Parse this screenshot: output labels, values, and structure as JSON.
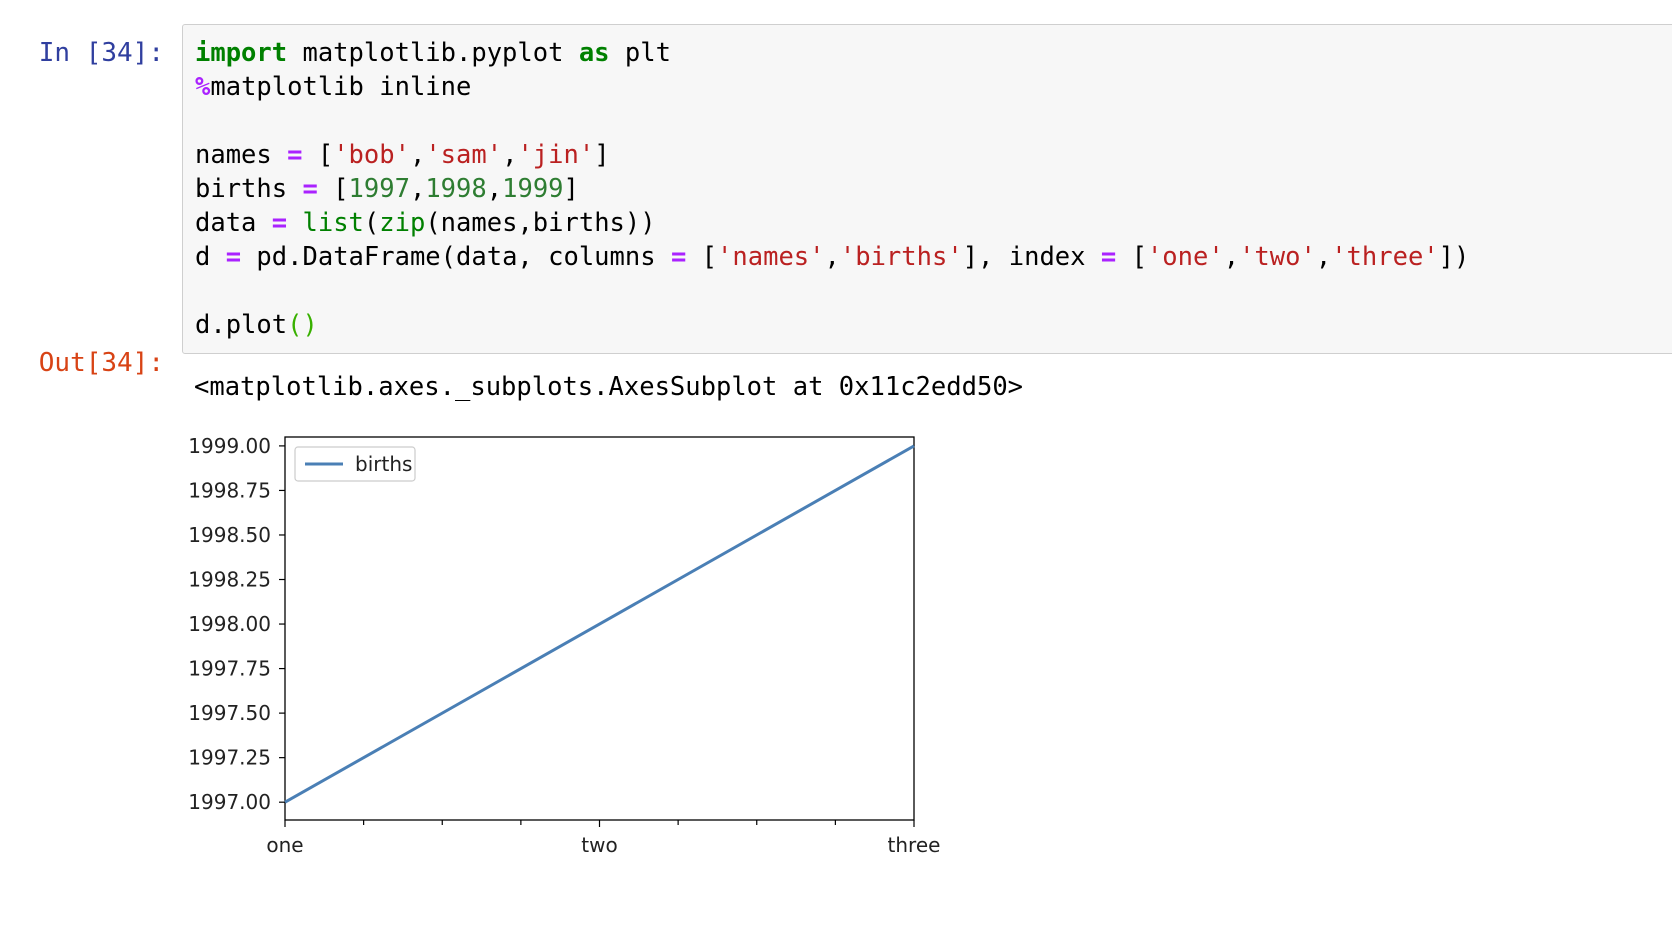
{
  "cell": {
    "in_prompt": "In [34]:",
    "out_prompt": "Out[34]:",
    "code_lines": [
      [
        {
          "t": "import",
          "c": "kw"
        },
        {
          "t": " matplotlib.pyplot "
        },
        {
          "t": "as",
          "c": "kw"
        },
        {
          "t": " plt"
        }
      ],
      [
        {
          "t": "%",
          "c": "op"
        },
        {
          "t": "matplotlib inline"
        }
      ],
      [],
      [
        {
          "t": "names "
        },
        {
          "t": "=",
          "c": "op"
        },
        {
          "t": " ["
        },
        {
          "t": "'bob'",
          "c": "str"
        },
        {
          "t": ","
        },
        {
          "t": "'sam'",
          "c": "str"
        },
        {
          "t": ","
        },
        {
          "t": "'jin'",
          "c": "str"
        },
        {
          "t": "]"
        }
      ],
      [
        {
          "t": "births "
        },
        {
          "t": "=",
          "c": "op"
        },
        {
          "t": " ["
        },
        {
          "t": "1997",
          "c": "num"
        },
        {
          "t": ","
        },
        {
          "t": "1998",
          "c": "num"
        },
        {
          "t": ","
        },
        {
          "t": "1999",
          "c": "num"
        },
        {
          "t": "]"
        }
      ],
      [
        {
          "t": "data "
        },
        {
          "t": "=",
          "c": "op"
        },
        {
          "t": " "
        },
        {
          "t": "list",
          "c": "bi"
        },
        {
          "t": "("
        },
        {
          "t": "zip",
          "c": "bi"
        },
        {
          "t": "(names,births))"
        }
      ],
      [
        {
          "t": "d "
        },
        {
          "t": "=",
          "c": "op"
        },
        {
          "t": " pd.DataFrame(data, columns "
        },
        {
          "t": "=",
          "c": "op"
        },
        {
          "t": " ["
        },
        {
          "t": "'names'",
          "c": "str"
        },
        {
          "t": ","
        },
        {
          "t": "'births'",
          "c": "str"
        },
        {
          "t": "], index "
        },
        {
          "t": "=",
          "c": "op"
        },
        {
          "t": " ["
        },
        {
          "t": "'one'",
          "c": "str"
        },
        {
          "t": ","
        },
        {
          "t": "'two'",
          "c": "str"
        },
        {
          "t": ","
        },
        {
          "t": "'three'",
          "c": "str"
        },
        {
          "t": "])"
        }
      ],
      [],
      [
        {
          "t": "d.plot"
        },
        {
          "t": "()",
          "c": "paren-hl"
        }
      ]
    ],
    "output_text": "<matplotlib.axes._subplots.AxesSubplot at 0x11c2edd50>"
  },
  "colors": {
    "line": "#4a7fb5",
    "axes": "#000000"
  },
  "chart_data": {
    "type": "line",
    "categories": [
      "one",
      "two",
      "three"
    ],
    "series": [
      {
        "name": "births",
        "values": [
          1997,
          1998,
          1999
        ]
      }
    ],
    "yticks": [
      "1997.00",
      "1997.25",
      "1997.50",
      "1997.75",
      "1998.00",
      "1998.25",
      "1998.50",
      "1998.75",
      "1999.00"
    ],
    "ylim": [
      1996.9,
      1999.05
    ],
    "legend": "upper left",
    "grid": false
  }
}
